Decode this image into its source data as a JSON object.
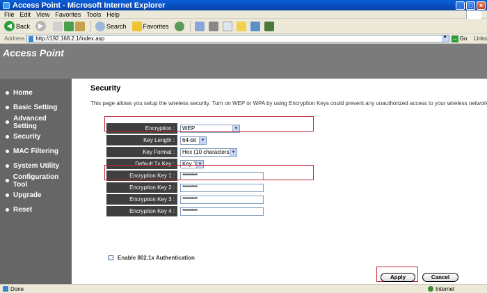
{
  "window": {
    "title": "Access Point - Microsoft Internet Explorer"
  },
  "menu": [
    "File",
    "Edit",
    "View",
    "Favorites",
    "Tools",
    "Help"
  ],
  "toolbar": {
    "back_label": "Back",
    "search_label": "Search",
    "favorites_label": "Favorites"
  },
  "address": {
    "label": "Address",
    "url": "http://192.168.2.1/index.asp",
    "go_label": "Go",
    "links_label": "Links"
  },
  "banner": {
    "brand": "Access Point"
  },
  "sidebar": {
    "items": [
      {
        "label": "Home"
      },
      {
        "label": "Basic Setting"
      },
      {
        "label": "Advanced Setting"
      },
      {
        "label": "Security"
      },
      {
        "label": "MAC Filtering"
      },
      {
        "label": "System Utility"
      },
      {
        "label": "Configuration Tool"
      },
      {
        "label": "Upgrade"
      },
      {
        "label": "Reset"
      }
    ]
  },
  "main": {
    "title": "Security",
    "description": "This page allows you setup the wireless security. Turn on WEP or WPA by using Encryption Keys could prevent any unauthorized access to your wireless network.",
    "fields": {
      "encryption": {
        "label": "Encryption :",
        "value": "WEP"
      },
      "key_length": {
        "label": "Key Length :",
        "value": "64-bit"
      },
      "key_format": {
        "label": "Key Format :",
        "value": "Hex (10 characters)"
      },
      "default_tx_key": {
        "label": "Default Tx Key :",
        "value": "Key 1"
      },
      "key1": {
        "label": "Encryption Key 1 :",
        "value": "**********"
      },
      "key2": {
        "label": "Encryption Key 2 :",
        "value": "**********"
      },
      "key3": {
        "label": "Encryption Key 3 :",
        "value": "**********"
      },
      "key4": {
        "label": "Encryption Key 4 :",
        "value": "**********"
      }
    },
    "auth_checkbox_label": "Enable 802.1x Authentication",
    "apply_label": "Apply",
    "cancel_label": "Cancel"
  },
  "status": {
    "text": "Done",
    "zone": "Internet"
  }
}
